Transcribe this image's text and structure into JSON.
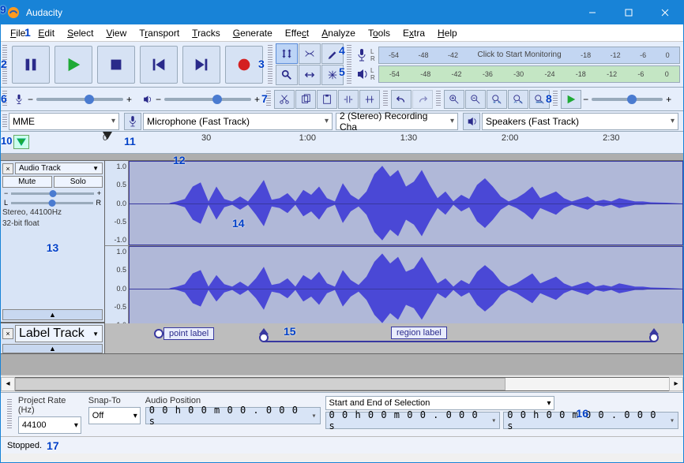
{
  "window": {
    "title": "Audacity"
  },
  "menu": [
    "File",
    "Edit",
    "Select",
    "View",
    "Transport",
    "Tracks",
    "Generate",
    "Effect",
    "Analyze",
    "Tools",
    "Extra",
    "Help"
  ],
  "meters": {
    "rec_hint": "Click to Start Monitoring",
    "ticks_rec": [
      "-54",
      "-48",
      "-42",
      "-18",
      "-12",
      "-6",
      "0"
    ],
    "ticks_play": [
      "-54",
      "-48",
      "-42",
      "-36",
      "-30",
      "-24",
      "-18",
      "-12",
      "-6",
      "0"
    ]
  },
  "devices": {
    "host": "MME",
    "input": "Microphone (Fast Track)",
    "channels": "2 (Stereo) Recording Cha",
    "output": "Speakers (Fast Track)"
  },
  "timeline": {
    "labels": [
      "0",
      "30",
      "1:00",
      "1:30",
      "2:00",
      "2:30"
    ]
  },
  "track": {
    "name": "Audio Track",
    "mute": "Mute",
    "solo": "Solo",
    "format": "Stereo, 44100Hz",
    "bits": "32-bit float",
    "vruler": [
      "1.0",
      "0.5",
      "0.0",
      "-0.5",
      "-1.0"
    ]
  },
  "labeltrack": {
    "name": "Label Track",
    "point": "point label",
    "region": "region label"
  },
  "selection": {
    "rate_label": "Project Rate (Hz)",
    "rate": "44100",
    "snap_label": "Snap-To",
    "snap": "Off",
    "pos_label": "Audio Position",
    "pos": "0 0 h 0 0 m 0 0 . 0 0 0 s",
    "range_label": "Start and End of Selection",
    "start": "0 0 h 0 0 m 0 0 . 0 0 0 s",
    "end": "0 0 h 0 0 m 0 0 . 0 0 0 s"
  },
  "status": {
    "state": "Stopped."
  },
  "annotations": [
    "1",
    "2",
    "3",
    "4",
    "5",
    "6",
    "7",
    "8",
    "9",
    "10",
    "11",
    "12",
    "13",
    "14",
    "15",
    "16",
    "17"
  ]
}
